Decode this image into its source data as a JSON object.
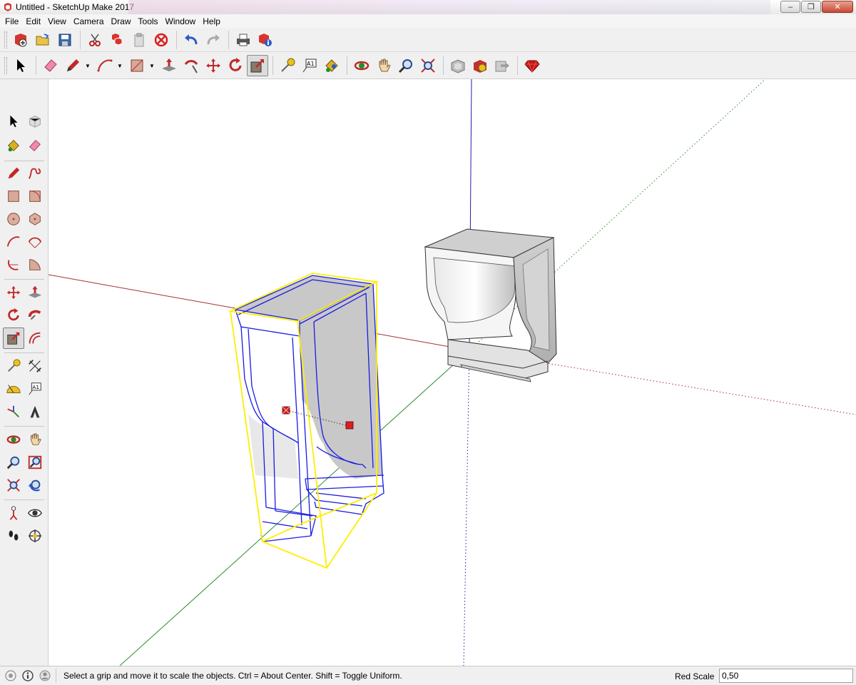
{
  "window": {
    "title": "Untitled - SketchUp Make 2017",
    "minimize": "–",
    "maximize": "❐",
    "close": "✕"
  },
  "menu": [
    "File",
    "Edit",
    "View",
    "Camera",
    "Draw",
    "Tools",
    "Window",
    "Help"
  ],
  "toolbar_top": [
    "new-icon",
    "open-icon",
    "save-icon",
    "cut-icon",
    "copy-icon",
    "paste-icon",
    "erase-icon",
    "undo-icon",
    "redo-icon",
    "print-icon",
    "model-info-icon"
  ],
  "toolbar_main": [
    "select-icon",
    "eraser-icon",
    "pencil-icon",
    "arc-icon",
    "rectangle-icon",
    "push-pull-icon",
    "follow-me-icon",
    "move-icon",
    "rotate-icon",
    "scale-icon",
    "tape-measure-icon",
    "text-icon",
    "paint-bucket-icon",
    "orbit-icon",
    "pan-icon",
    "zoom-icon",
    "zoom-extents-icon",
    "warehouse-icon",
    "extension-icon",
    "share-icon",
    "ruby-icon"
  ],
  "left_toolbar": [
    "select-icon",
    "make-component-icon",
    "paint-bucket-icon",
    "eraser-icon",
    "line-icon",
    "freehand-icon",
    "rectangle-icon",
    "rotated-rectangle-icon",
    "circle-icon",
    "polygon-icon",
    "arc-icon",
    "two-point-arc-icon",
    "three-point-arc-icon",
    "pie-icon",
    "move-icon",
    "push-pull-icon",
    "rotate-icon",
    "follow-me-icon",
    "scale-icon",
    "offset-icon",
    "tape-measure-icon",
    "dimension-icon",
    "protractor-icon",
    "text-icon",
    "axes-icon",
    "3d-text-icon",
    "orbit-icon",
    "pan-icon",
    "zoom-icon",
    "zoom-window-icon",
    "zoom-extents-icon",
    "previous-view-icon",
    "position-camera-icon",
    "look-around-icon",
    "walk-icon",
    "section-plane-icon"
  ],
  "active_tool": "scale-icon",
  "status": {
    "message": "Select a grip and move it to scale the objects. Ctrl = About Center. Shift = Toggle Uniform.",
    "vcb_label": "Red Scale",
    "vcb_value": "0,50"
  },
  "colors": {
    "red_axis": "#a03030",
    "green_axis": "#2e8b2e",
    "blue_axis": "#2020a0",
    "selection": "#1a1ae6",
    "scale_box": "#ffee00",
    "face_gray": "#c8c8c8"
  }
}
